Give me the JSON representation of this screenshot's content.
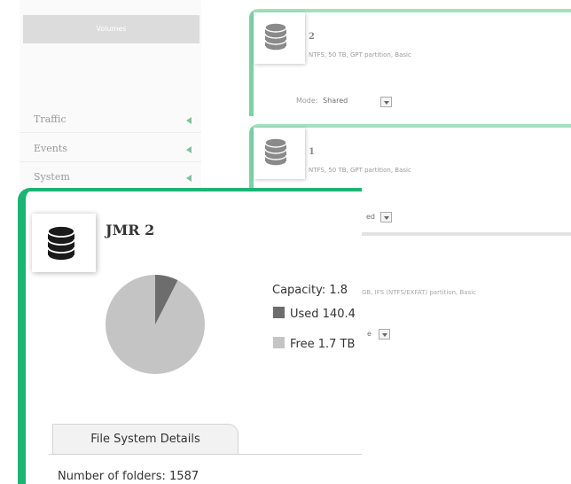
{
  "sidebar": {
    "active_item": "Volumes",
    "items": [
      {
        "label": "Traffic"
      },
      {
        "label": "Events"
      },
      {
        "label": "System"
      }
    ]
  },
  "volume_cards": [
    {
      "name": "2",
      "info": "NTFS, 50 TB, GPT partition, Basic",
      "mode_label": "Mode:",
      "mode_value": "Shared"
    },
    {
      "name": "1",
      "info": "NTFS, 50 TB, GPT partition, Basic",
      "mode_partial": "ed"
    }
  ],
  "background_card_3": {
    "info": "GB, IFS (NTFS/EXFAT) partition, Basic",
    "mode_partial": "e"
  },
  "detail_dialog": {
    "title": "JMR 2",
    "capacity_label": "Capacity: 1.8",
    "used_label": "Used 140.4",
    "free_label": "Free 1.7 TB",
    "used_fraction": 0.075,
    "used_color": "#6d6d6d",
    "free_color": "#c4c4c4",
    "tab_label": "File System Details",
    "folders_label": "Number of folders: 1587"
  },
  "colors": {
    "accent": "#1cb373",
    "accent_light": "#7ed0a6"
  },
  "icons": {
    "volume": "database-icon",
    "nav_arrow": "triangle-left-icon",
    "dropdown": "chevron-down-icon"
  }
}
